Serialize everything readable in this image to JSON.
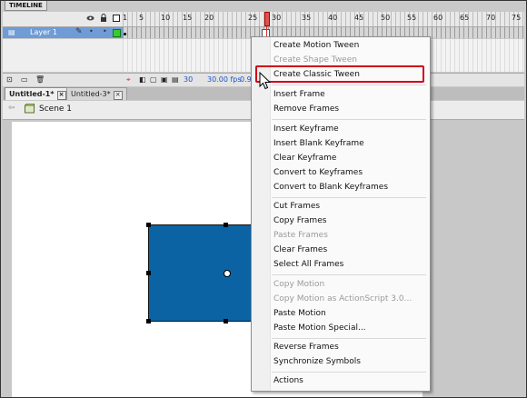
{
  "timeline": {
    "tab_label": "TIMELINE",
    "frame_numbers": [
      "1",
      "5",
      "10",
      "15",
      "20",
      "25",
      "30",
      "35",
      "40",
      "45",
      "50",
      "55",
      "60",
      "65",
      "70",
      "75"
    ],
    "layer_name": "Layer 1",
    "fps": "30.00 fps",
    "time": "0.9"
  },
  "document_tabs": [
    {
      "label": "Untitled-1*"
    },
    {
      "label": "Untitled-3*"
    }
  ],
  "edit_bar": {
    "scene_label": "Scene 1"
  },
  "context_menu": {
    "items": [
      {
        "label": "Create Motion Tween",
        "enabled": true
      },
      {
        "label": "Create Shape Tween",
        "enabled": false
      },
      {
        "label": "Create Classic Tween",
        "enabled": true
      },
      {
        "label": "Insert Frame",
        "enabled": true
      },
      {
        "label": "Remove Frames",
        "enabled": true
      },
      {
        "label": "Insert Keyframe",
        "enabled": true
      },
      {
        "label": "Insert Blank Keyframe",
        "enabled": true
      },
      {
        "label": "Clear Keyframe",
        "enabled": true
      },
      {
        "label": "Convert to Keyframes",
        "enabled": true
      },
      {
        "label": "Convert to Blank Keyframes",
        "enabled": true
      },
      {
        "label": "Cut Frames",
        "enabled": true
      },
      {
        "label": "Copy Frames",
        "enabled": true
      },
      {
        "label": "Paste Frames",
        "enabled": false
      },
      {
        "label": "Clear Frames",
        "enabled": true
      },
      {
        "label": "Select All Frames",
        "enabled": true
      },
      {
        "label": "Copy Motion",
        "enabled": false
      },
      {
        "label": "Copy Motion as ActionScript 3.0...",
        "enabled": false
      },
      {
        "label": "Paste Motion",
        "enabled": true
      },
      {
        "label": "Paste Motion Special...",
        "enabled": true
      },
      {
        "label": "Reverse Frames",
        "enabled": true
      },
      {
        "label": "Synchronize Symbols",
        "enabled": true
      },
      {
        "label": "Actions",
        "enabled": true
      }
    ],
    "highlighted_item": "Create Classic Tween"
  },
  "colors": {
    "shape_fill": "#0b63a3",
    "highlight_border": "#d0021b",
    "playhead": "#e05050"
  }
}
